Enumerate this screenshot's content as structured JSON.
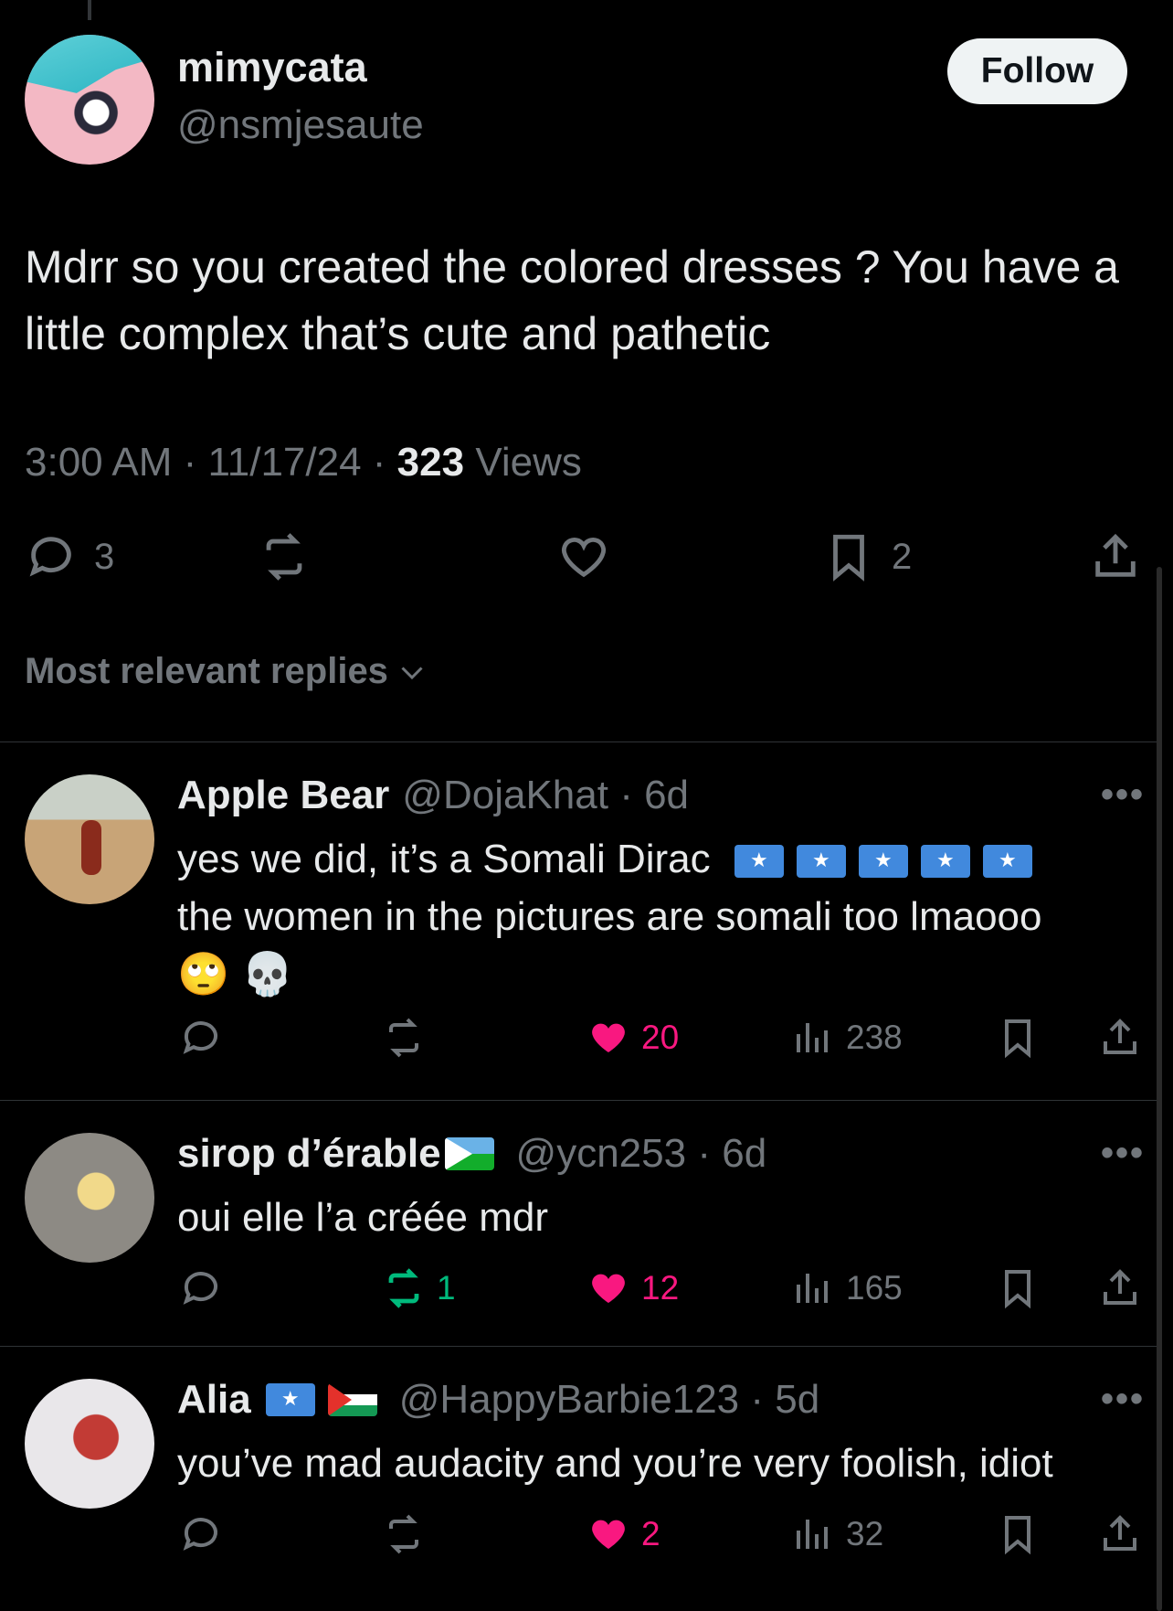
{
  "tweet": {
    "name": "mimycata",
    "handle": "@nsmjesaute",
    "follow_label": "Follow",
    "text": "Mdrr so you created the colored dresses ? You have a little complex that’s cute and pathetic",
    "time": "3:00 AM",
    "date": "11/17/24",
    "views_count": "323",
    "views_label": "Views",
    "reply_count": "3",
    "bookmark_count": "2"
  },
  "sort_label": "Most relevant replies",
  "replies": [
    {
      "name": "Apple Bear",
      "handle": "@DojaKhat",
      "age": "6d",
      "text_line1": "yes we did, it’s a Somali Dirac",
      "text_rest": "the women in the pictures are somali too lmaooo",
      "emoji": "🙄 💀",
      "likes": "20",
      "views": "238"
    },
    {
      "name": "sirop d’érable",
      "handle": "@ycn253",
      "age": "6d",
      "text": "oui elle l’a créée mdr",
      "reposts": "1",
      "likes": "12",
      "views": "165"
    },
    {
      "name": "Alia",
      "handle": "@HappyBarbie123",
      "age": "5d",
      "text": "you’ve mad audacity and you’re very foolish, idiot",
      "likes": "2",
      "views": "32"
    }
  ],
  "more_label": "•••",
  "colors": {
    "background": "#000000",
    "like_pink": "#f91880",
    "repost_green": "#00ba7c",
    "muted": "#71767b"
  }
}
